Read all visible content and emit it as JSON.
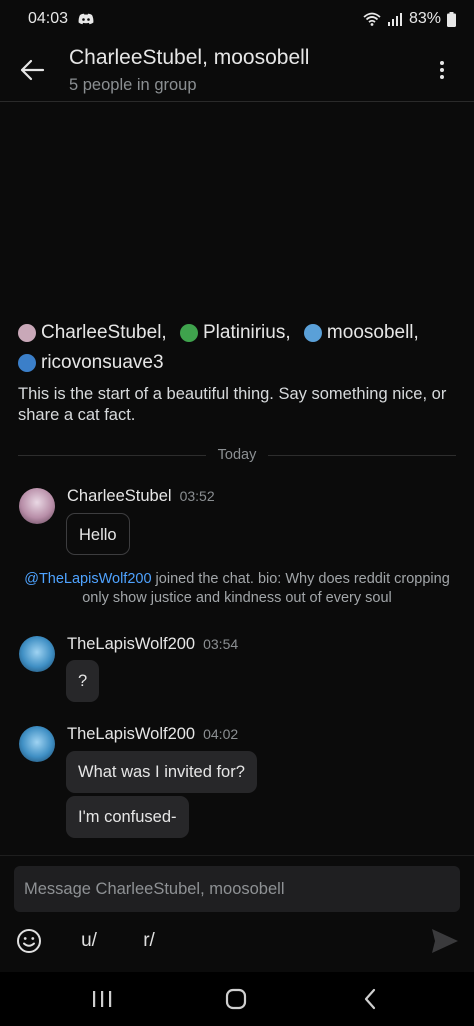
{
  "status_bar": {
    "time": "04:03",
    "battery": "83%"
  },
  "header": {
    "title": "CharleeStubel, moosobell",
    "subtitle": "5 people in group"
  },
  "intro": {
    "members": [
      {
        "name": "CharleeStubel,",
        "avatar_color": "#c9a8b8"
      },
      {
        "name": "Platinirius,",
        "avatar_color": "#3fa34d"
      },
      {
        "name": "moosobell,",
        "avatar_color": "#5aa0d8"
      },
      {
        "name": "ricovonsuave3",
        "avatar_color": "#3b7fc9"
      }
    ],
    "text": "This is the start of a beautiful thing. Say something nice, or share a cat fact."
  },
  "divider_label": "Today",
  "messages": [
    {
      "author": "CharleeStubel",
      "time": "03:52",
      "bubbles": [
        "Hello"
      ]
    },
    {
      "author": "TheLapisWolf200",
      "time": "03:54",
      "bubbles": [
        "?"
      ]
    },
    {
      "author": "TheLapisWolf200",
      "time": "04:02",
      "bubbles": [
        "What was I invited for?",
        "I'm confused-"
      ]
    }
  ],
  "system_message": {
    "mention": "@TheLapisWolf200",
    "text": " joined the chat. bio: Why does reddit cropping only show justice and kindness out of every soul"
  },
  "composer": {
    "placeholder": "Message CharleeStubel, moosobell",
    "user_prefix": "u/",
    "subreddit_prefix": "r/"
  },
  "colors": {
    "background": "#0b0b0b",
    "bubble": "#272729",
    "mention": "#4fa3ff",
    "muted": "#8b8f92"
  }
}
